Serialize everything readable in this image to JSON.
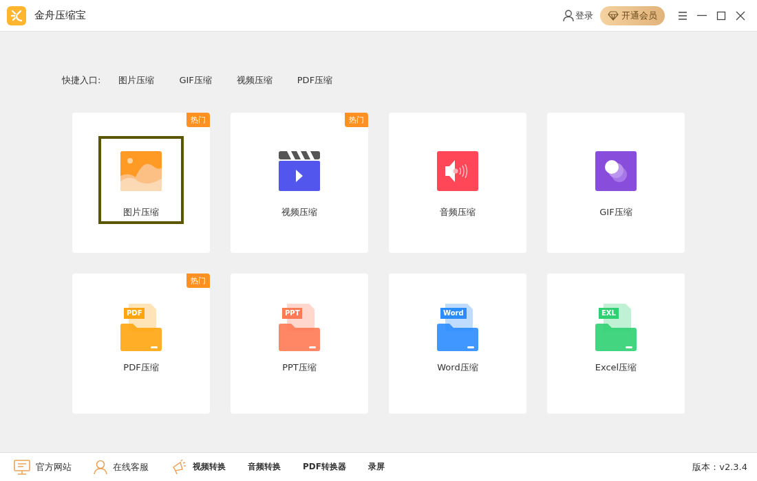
{
  "window": {
    "title": "金舟压缩宝",
    "login": "登录",
    "vip": "开通会员"
  },
  "quick_links": {
    "label": "快捷入口:",
    "items": [
      "图片压缩",
      "GIF压缩",
      "视频压缩",
      "PDF压缩"
    ]
  },
  "tiles": [
    {
      "kind": "image",
      "label": "图片压缩",
      "badge": "热门",
      "selected": true
    },
    {
      "kind": "video",
      "label": "视频压缩",
      "badge": "热门",
      "selected": false
    },
    {
      "kind": "audio",
      "label": "音频压缩",
      "selected": false
    },
    {
      "kind": "gif",
      "label": "GIF压缩",
      "selected": false
    },
    {
      "kind": "file",
      "tag": "PDF",
      "color": "#ffa50f",
      "label": "PDF压缩",
      "badge": "热门",
      "selected": false
    },
    {
      "kind": "file",
      "tag": "PPT",
      "color": "#ff7a55",
      "label": "PPT压缩",
      "selected": false
    },
    {
      "kind": "file",
      "tag": "Word",
      "color": "#2b8cff",
      "label": "Word压缩",
      "selected": false
    },
    {
      "kind": "file",
      "tag": "EXL",
      "color": "#2fd072",
      "label": "Excel压缩",
      "selected": false
    }
  ],
  "footer": {
    "items": [
      {
        "kind": "monitor",
        "label": "官方网站"
      },
      {
        "kind": "person",
        "label": "在线客服"
      },
      {
        "kind": "megaphone",
        "label": "视频转换"
      },
      {
        "kind": "plain",
        "label": "音频转换"
      },
      {
        "kind": "plain",
        "label": "PDF转换器"
      },
      {
        "kind": "plain",
        "label": "录屏"
      }
    ],
    "version": "版本：v2.3.4"
  }
}
